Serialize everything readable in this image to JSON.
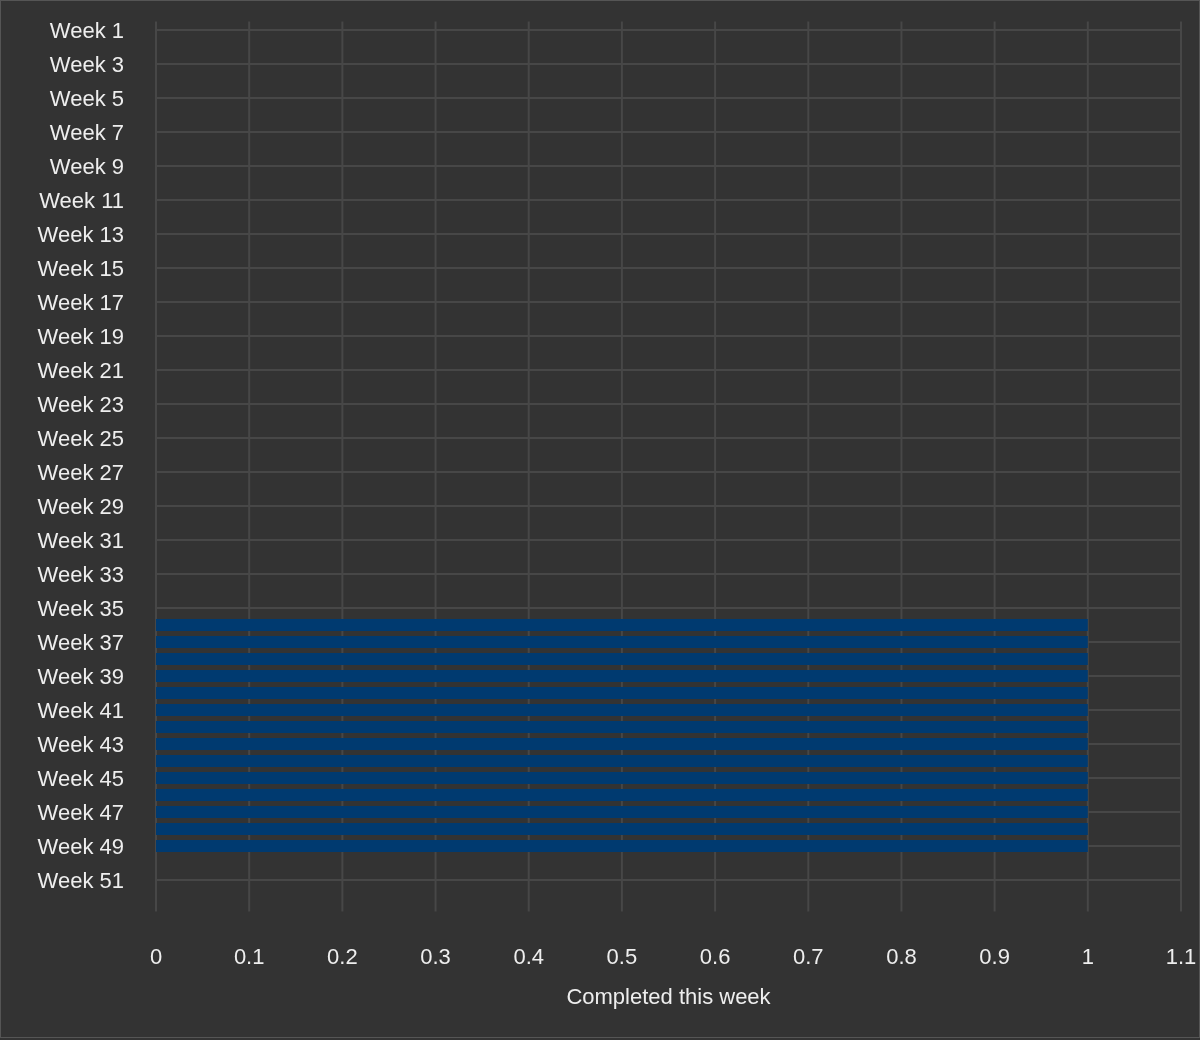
{
  "chart_data": {
    "type": "bar",
    "orientation": "horizontal",
    "grid": true,
    "xlabel": "Completed this week",
    "xlim": [
      0,
      1.1
    ],
    "xticks": [
      0,
      0.1,
      0.2,
      0.3,
      0.4,
      0.5,
      0.6,
      0.7,
      0.8,
      0.9,
      1,
      1.1
    ],
    "categories": [
      "Week 1",
      null,
      "Week 3",
      null,
      "Week 5",
      null,
      "Week 7",
      null,
      "Week 9",
      null,
      "Week 11",
      null,
      "Week 13",
      null,
      "Week 15",
      null,
      "Week 17",
      null,
      "Week 19",
      null,
      "Week 21",
      null,
      "Week 23",
      null,
      "Week 25",
      null,
      "Week 27",
      null,
      "Week 29",
      null,
      "Week 31",
      null,
      "Week 33",
      null,
      "Week 35",
      null,
      "Week 37",
      null,
      "Week 39",
      null,
      "Week 41",
      null,
      "Week 43",
      null,
      "Week 45",
      null,
      "Week 47",
      null,
      "Week 49",
      null,
      "Week 51",
      null
    ],
    "series": [
      {
        "color": "#003a70",
        "values": [
          0,
          0,
          0,
          0,
          0,
          0,
          0,
          0,
          0,
          0,
          0,
          0,
          0,
          0,
          0,
          0,
          0,
          0,
          0,
          0,
          0,
          0,
          0,
          0,
          0,
          0,
          0,
          0,
          0,
          0,
          0,
          0,
          0,
          0,
          0,
          1,
          1,
          1,
          1,
          1,
          1,
          1,
          1,
          1,
          1,
          1,
          1,
          1,
          1,
          0,
          0,
          0
        ]
      }
    ]
  }
}
